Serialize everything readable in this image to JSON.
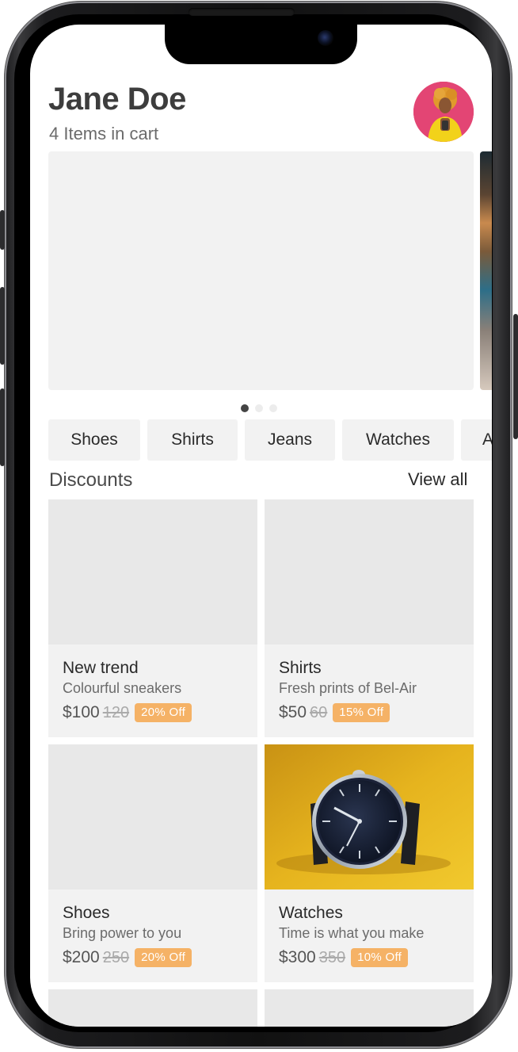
{
  "header": {
    "name": "Jane Doe",
    "cart_count": "4 Items in cart"
  },
  "carousel": {
    "active_index": 0,
    "page_count": 3
  },
  "categories": [
    "Shoes",
    "Shirts",
    "Jeans",
    "Watches",
    "A"
  ],
  "discounts": {
    "title": "Discounts",
    "view_all": "View all",
    "products": [
      {
        "title": "New trend",
        "subtitle": "Colourful sneakers",
        "price": "$100",
        "old_price": "120",
        "badge": "20% Off"
      },
      {
        "title": "Shirts",
        "subtitle": "Fresh prints of Bel-Air",
        "price": "$50",
        "old_price": "60",
        "badge": "15% Off"
      },
      {
        "title": "Shoes",
        "subtitle": "Bring power to you",
        "price": "$200",
        "old_price": "250",
        "badge": "20% Off"
      },
      {
        "title": "Watches",
        "subtitle": "Time is what you make",
        "price": "$300",
        "old_price": "350",
        "badge": "10% Off"
      }
    ]
  },
  "colors": {
    "badge": "#f5b266",
    "card_bg": "#f2f2f2",
    "image_placeholder": "#e8e8e8",
    "watch_bg": "#e0b21d"
  }
}
